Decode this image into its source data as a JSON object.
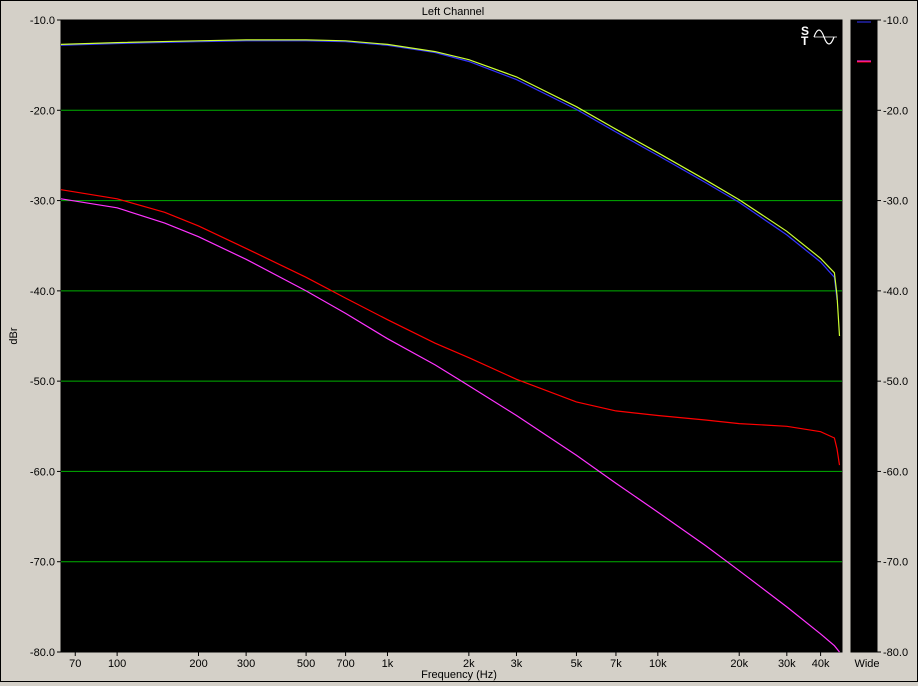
{
  "chart_data": {
    "type": "line",
    "title": "Left Channel",
    "xlabel": "Frequency (Hz)",
    "ylabel": "dBr",
    "xscale": "log",
    "xlim": [
      62,
      48000
    ],
    "ylim": [
      -80,
      -10
    ],
    "grid": true,
    "x_tick_values": [
      70,
      100,
      200,
      300,
      500,
      700,
      1000,
      2000,
      3000,
      5000,
      7000,
      10000,
      20000,
      30000,
      40000
    ],
    "x_tick_labels": [
      "70",
      "100",
      "200",
      "300",
      "500",
      "700",
      "1k",
      "2k",
      "3k",
      "5k",
      "7k",
      "10k",
      "20k",
      "30k",
      "40k"
    ],
    "y_ticks": [
      -10,
      -20,
      -30,
      -40,
      -50,
      -60,
      -70,
      -80
    ],
    "y_tick_labels": [
      "-10.0",
      "-20.0",
      "-30.0",
      "-40.0",
      "-50.0",
      "-60.0",
      "-70.0",
      "-80.0"
    ],
    "right_scale_label": "Wide",
    "series": [
      {
        "color": "#3333ff",
        "x": [
          62,
          100,
          200,
          300,
          500,
          700,
          1000,
          1500,
          2000,
          3000,
          5000,
          7000,
          10000,
          15000,
          20000,
          30000,
          40000,
          45000,
          46000
        ],
        "y": [
          -12.8,
          -12.6,
          -12.4,
          -12.3,
          -12.3,
          -12.4,
          -12.8,
          -13.6,
          -14.6,
          -16.6,
          -19.9,
          -22.4,
          -25.0,
          -28.0,
          -30.2,
          -33.8,
          -36.8,
          -38.5,
          -41.0
        ]
      },
      {
        "color": "#ccff33",
        "x": [
          62,
          100,
          200,
          300,
          500,
          700,
          1000,
          1500,
          2000,
          3000,
          5000,
          7000,
          10000,
          15000,
          20000,
          30000,
          40000,
          45000,
          46000,
          47000
        ],
        "y": [
          -12.7,
          -12.5,
          -12.3,
          -12.2,
          -12.2,
          -12.3,
          -12.7,
          -13.5,
          -14.4,
          -16.3,
          -19.6,
          -22.1,
          -24.7,
          -27.7,
          -29.9,
          -33.4,
          -36.4,
          -38.0,
          -40.5,
          -45.0
        ]
      },
      {
        "color": "#ff0000",
        "x": [
          62,
          100,
          150,
          200,
          300,
          500,
          700,
          1000,
          1500,
          2000,
          3000,
          5000,
          7000,
          10000,
          15000,
          20000,
          30000,
          40000,
          45000,
          46000,
          47000
        ],
        "y": [
          -28.8,
          -29.8,
          -31.3,
          -32.8,
          -35.3,
          -38.5,
          -40.8,
          -43.2,
          -45.8,
          -47.4,
          -49.8,
          -52.3,
          -53.3,
          -53.8,
          -54.3,
          -54.7,
          -55.0,
          -55.6,
          -56.3,
          -57.5,
          -59.3
        ]
      },
      {
        "color": "#ff33ff",
        "x": [
          62,
          100,
          150,
          200,
          300,
          500,
          700,
          1000,
          1500,
          2000,
          3000,
          5000,
          7000,
          10000,
          15000,
          20000,
          30000,
          40000,
          45000,
          47000
        ],
        "y": [
          -29.8,
          -30.8,
          -32.5,
          -34.0,
          -36.5,
          -40.0,
          -42.5,
          -45.3,
          -48.2,
          -50.5,
          -53.8,
          -58.2,
          -61.3,
          -64.5,
          -68.2,
          -71.0,
          -75.0,
          -78.0,
          -79.3,
          -80.0
        ]
      }
    ]
  },
  "icons": {
    "st_logo": "ST-sine-icon"
  }
}
